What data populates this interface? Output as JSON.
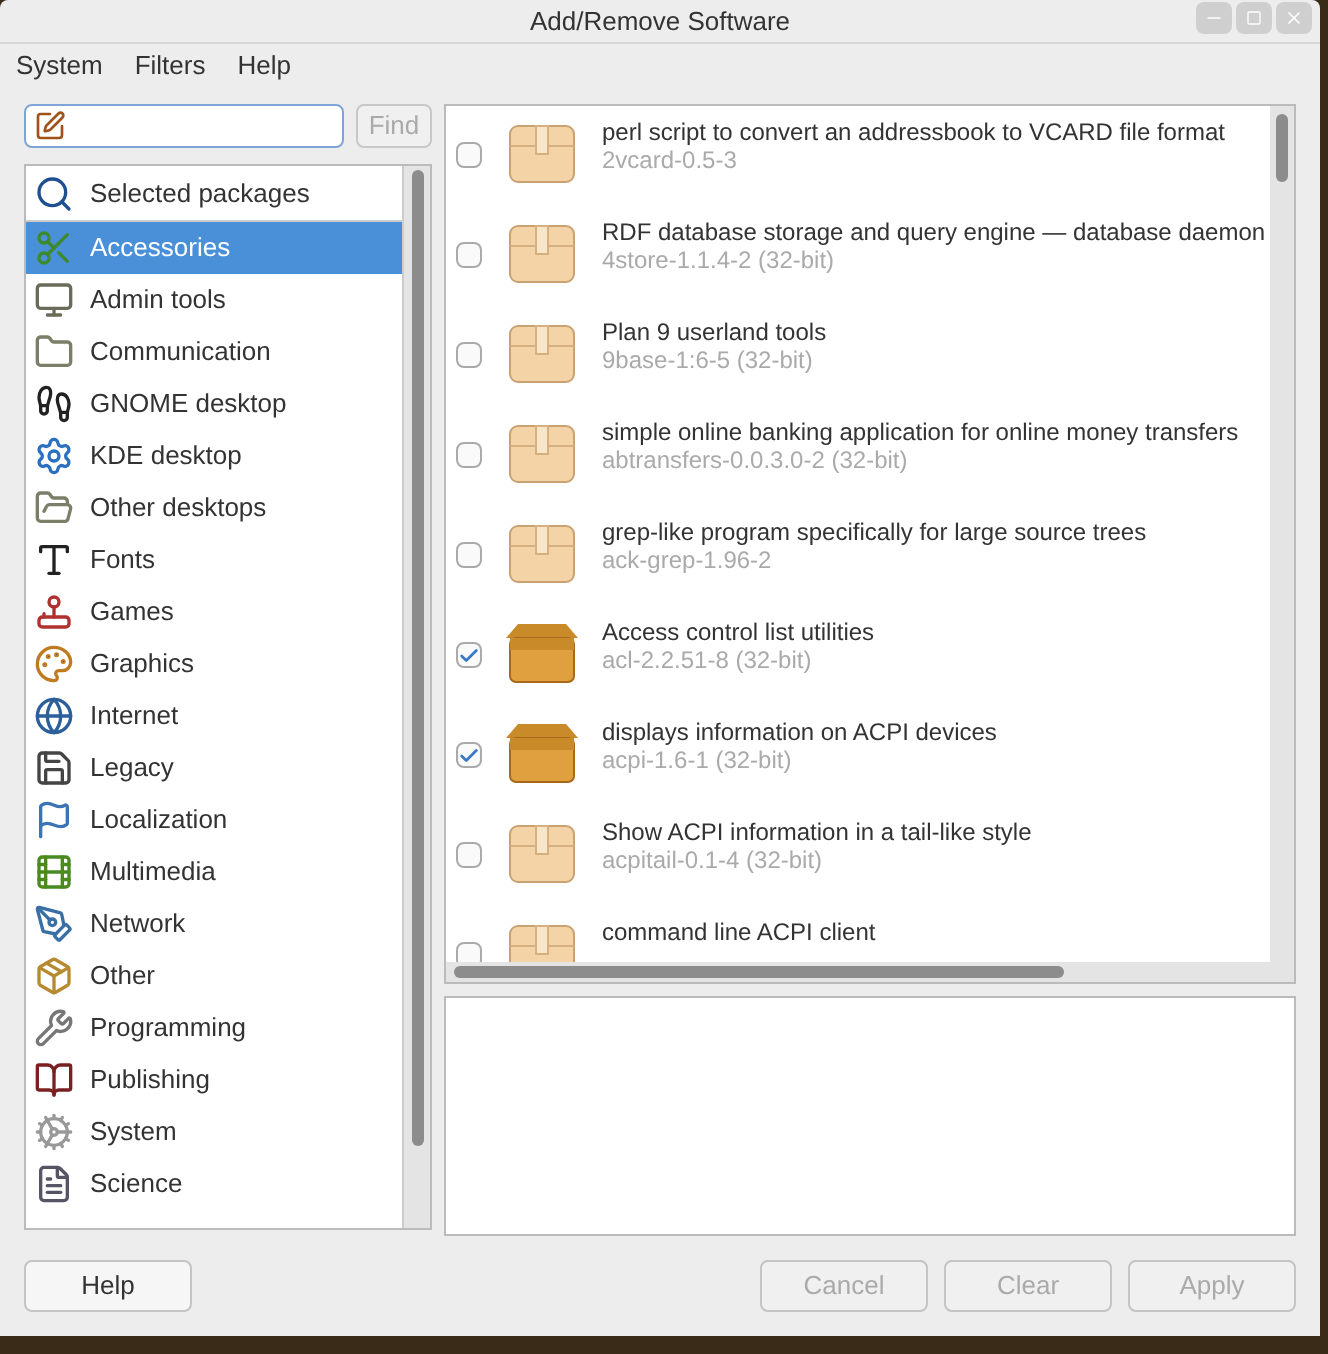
{
  "window": {
    "title": "Add/Remove Software"
  },
  "menu": [
    "System",
    "Filters",
    "Help"
  ],
  "search": {
    "find_button": {
      "label": "Find",
      "disabled": true
    }
  },
  "categories": [
    {
      "label": "Selected packages",
      "selected": false
    },
    {
      "label": "Accessories",
      "selected": true
    },
    {
      "label": "Admin tools",
      "selected": false
    },
    {
      "label": "Communication",
      "selected": false
    },
    {
      "label": "GNOME desktop",
      "selected": false
    },
    {
      "label": "KDE desktop",
      "selected": false
    },
    {
      "label": "Other desktops",
      "selected": false
    },
    {
      "label": "Fonts",
      "selected": false
    },
    {
      "label": "Games",
      "selected": false
    },
    {
      "label": "Graphics",
      "selected": false
    },
    {
      "label": "Internet",
      "selected": false
    },
    {
      "label": "Legacy",
      "selected": false
    },
    {
      "label": "Localization",
      "selected": false
    },
    {
      "label": "Multimedia",
      "selected": false
    },
    {
      "label": "Network",
      "selected": false
    },
    {
      "label": "Other",
      "selected": false
    },
    {
      "label": "Programming",
      "selected": false
    },
    {
      "label": "Publishing",
      "selected": false
    },
    {
      "label": "System",
      "selected": false
    },
    {
      "label": "Science",
      "selected": false
    }
  ],
  "packages": [
    {
      "summary": "perl script to convert an addressbook to VCARD file format",
      "version": "2vcard-0.5-3",
      "checked": false
    },
    {
      "summary": "RDF database storage and query engine — database daemon",
      "version": "4store-1.1.4-2 (32-bit)",
      "checked": false
    },
    {
      "summary": "Plan 9 userland tools",
      "version": "9base-1:6-5 (32-bit)",
      "checked": false
    },
    {
      "summary": "simple online banking application for online money transfers",
      "version": "abtransfers-0.0.3.0-2 (32-bit)",
      "checked": false
    },
    {
      "summary": "grep-like program specifically for large source trees",
      "version": "ack-grep-1.96-2",
      "checked": false
    },
    {
      "summary": "Access control list utilities",
      "version": "acl-2.2.51-8 (32-bit)",
      "checked": true
    },
    {
      "summary": "displays information on ACPI devices",
      "version": "acpi-1.6-1 (32-bit)",
      "checked": true
    },
    {
      "summary": "Show ACPI information in a tail-like style",
      "version": "acpitail-0.1-4 (32-bit)",
      "checked": false
    },
    {
      "summary": "command line ACPI client",
      "checked": false
    }
  ],
  "buttons": [
    {
      "label": "Help",
      "disabled": false
    },
    {
      "label": "Cancel",
      "disabled": true
    },
    {
      "label": "Clear",
      "disabled": true
    },
    {
      "label": "Apply",
      "disabled": true
    }
  ]
}
